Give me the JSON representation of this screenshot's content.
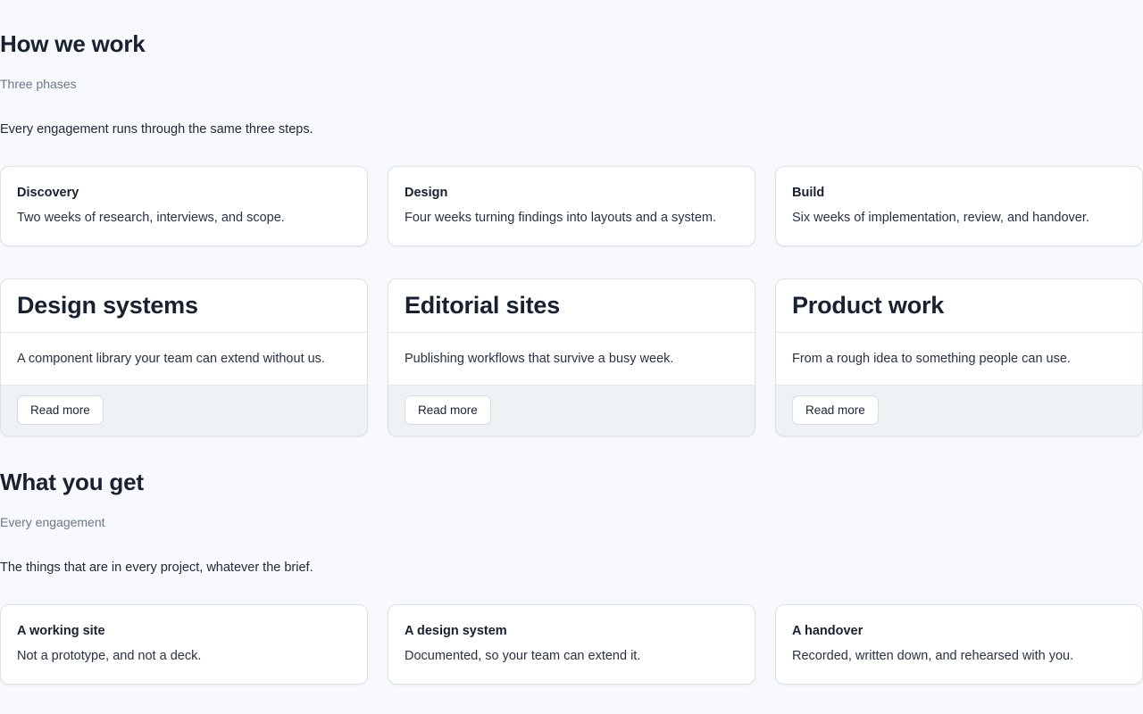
{
  "how_we_work": {
    "title": "How we work",
    "subtitle": "Three phases",
    "description": "Every engagement runs through the same three steps.",
    "phases": [
      {
        "title": "Discovery",
        "text": "Two weeks of research, interviews, and scope."
      },
      {
        "title": "Design",
        "text": "Four weeks turning findings into layouts and a system."
      },
      {
        "title": "Build",
        "text": "Six weeks of implementation, review, and handover."
      }
    ]
  },
  "services": [
    {
      "title": "Design systems",
      "text": "A component library your team can extend without us.",
      "button": "Read more"
    },
    {
      "title": "Editorial sites",
      "text": "Publishing workflows that survive a busy week.",
      "button": "Read more"
    },
    {
      "title": "Product work",
      "text": "From a rough idea to something people can use.",
      "button": "Read more"
    }
  ],
  "what_you_get": {
    "title": "What you get",
    "subtitle": "Every engagement",
    "description": "The things that are in every project, whatever the brief.",
    "items": [
      {
        "title": "A working site",
        "text": "Not a prototype, and not a deck."
      },
      {
        "title": "A design system",
        "text": "Documented, so your team can extend it."
      },
      {
        "title": "A handover",
        "text": "Recorded, written down, and rehearsed with you."
      }
    ]
  }
}
